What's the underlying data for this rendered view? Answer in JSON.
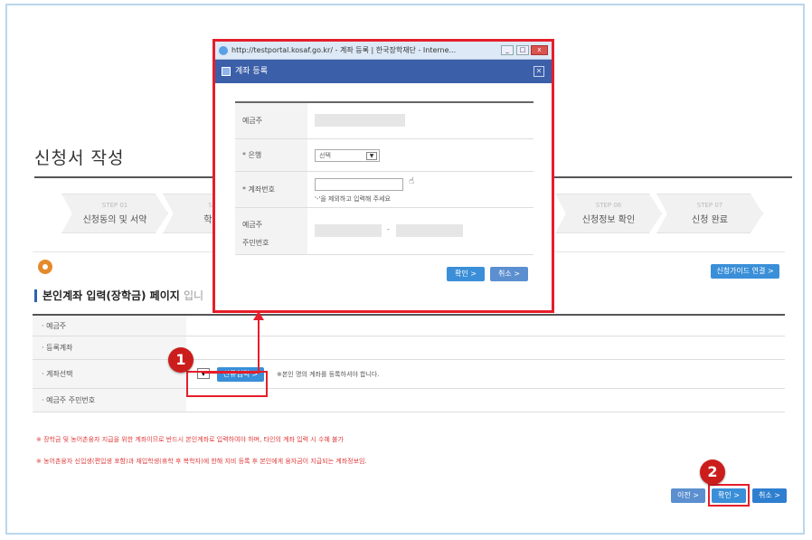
{
  "page": {
    "title": "신청서 작성",
    "guide_button": "신청가이드 연결 >",
    "section_title": "본인계좌 입력(장학금) 페이지",
    "section_suffix": "입니",
    "steps": [
      {
        "top": "STEP 01",
        "label": "신청동의 및 서약"
      },
      {
        "top": "STEP",
        "label": "학교정"
      },
      {
        "top": "",
        "label": ""
      },
      {
        "top": "",
        "label": ""
      },
      {
        "top": "STEP 06",
        "label": "신청정보 확인"
      },
      {
        "top": "STEP 07",
        "label": "신청 완료"
      }
    ],
    "form_rows": [
      {
        "label": "· 예금주"
      },
      {
        "label": "· 등록계좌"
      },
      {
        "label": "· 계좌선택"
      },
      {
        "label": "· 예금주 주민번호"
      }
    ],
    "new_input_button": "신규입력 >",
    "account_notice": "※본인 명의 계좌를 등록하셔야 합니다.",
    "notices": [
      "※ 장학금 및 농어촌융자 지급을 위한 계좌이므로 반드시 본인계좌로 입력하여야 하며, 타인의 계좌 입력 시 수혜 불가",
      "※ 농어촌융자 신입생(편입생 포함)과 재입학생(휴학 후 복학자)에 한해 지비 등록 후 본인에게 융자금이 지급되는 계좌정보임."
    ],
    "bottom_buttons": {
      "prev": "이전 >",
      "confirm": "확인 >",
      "cancel": "취소 >"
    }
  },
  "popup": {
    "window_title": "http://testportal.kosaf.go.kr/ - 계좌 등록 | 한국장학재단 - Interne...",
    "header_title": "계좌 등록",
    "rows": {
      "holder_label": "예금주",
      "bank_label": "* 은행",
      "bank_select": "선택",
      "account_label": "* 계좌번호",
      "account_hint": "'-'을 제외하고 입력해 주세요",
      "ssn_label_1": "예금주",
      "ssn_label_2": "주민번호",
      "ssn_dash": "-"
    },
    "confirm_button": "확인 >",
    "cancel_button": "취소 >"
  },
  "annotations": {
    "badge1": "1",
    "badge2": "2"
  },
  "colors": {
    "highlight": "#e51e2a",
    "accent_blue": "#3a8fd8",
    "popup_header": "#3b5fa8",
    "badge": "#cc1d1d"
  }
}
